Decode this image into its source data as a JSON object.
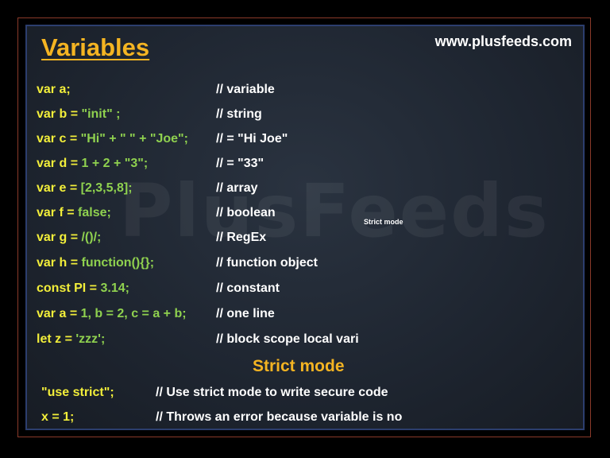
{
  "header": {
    "title": "Variables",
    "site": "www.plusfeeds.com"
  },
  "watermark": "PlusFeeds",
  "mini_label": "Strict mode",
  "rows": [
    {
      "kw": "var a;",
      "val": "",
      "comment": "// variable"
    },
    {
      "kw": "var b  =",
      "val": "\"init\" ;",
      "comment": "// string"
    },
    {
      "kw": "var c  =",
      "val": "\"Hi\" + \" \" + \"Joe\";",
      "comment": "// = \"Hi Joe\""
    },
    {
      "kw": "var d  =",
      "val": "1 + 2 + \"3\";",
      "comment": "// = \"33\""
    },
    {
      "kw": "var e  =",
      "val": "[2,3,5,8];",
      "comment": "// array"
    },
    {
      "kw": "var f  =",
      "val": "false;",
      "comment": "// boolean"
    },
    {
      "kw": "var g  =",
      "val": "/()/;",
      "comment": "// RegEx"
    },
    {
      "kw": "var h  =",
      "val": "function(){};",
      "comment": "// function object"
    },
    {
      "kw": "const PI  =",
      "val": "3.14;",
      "comment": "// constant"
    },
    {
      "kw": "var a  =",
      "val": "1, b = 2, c = a + b;",
      "comment": "// one line"
    },
    {
      "kw": "let z  =",
      "val": "'zzz';",
      "comment": "// block scope local vari"
    }
  ],
  "strict": {
    "heading": "Strict mode",
    "rows": [
      {
        "code": "\"use strict\";",
        "comment": "// Use strict mode to write secure code"
      },
      {
        "code": "x = 1;",
        "comment": "// Throws an error because variable is no"
      }
    ]
  }
}
